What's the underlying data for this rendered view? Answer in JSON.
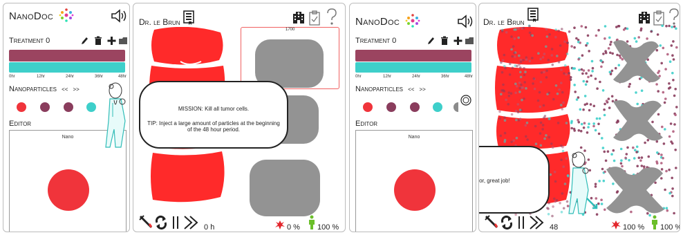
{
  "screen1": {
    "app_name": "NanoDoc",
    "treatment_title": "Treatment 0",
    "timeline_ticks": [
      "0hr",
      "12hr",
      "24hr",
      "36hr",
      "48hr"
    ],
    "nanoparticles_label": "Nanoparticles",
    "np_prev": "<<",
    "np_next": ">>",
    "editor_label": "Editor",
    "editor_canvas_title": "Nano",
    "doctor_name": "Dr. le Brun",
    "grid_value": "1700",
    "mission_text": "MISSION: Kill all tumor cells.",
    "tip_text": "TIP: Inject a large amount of particles at the beginning of the 48 hour period.",
    "timer_value": "0",
    "timer_unit": "h",
    "tumor_killed": "0 %",
    "health": "100 %"
  },
  "screen2": {
    "app_name": "NanoDoc",
    "treatment_title": "Treatment 0",
    "timeline_ticks": [
      "0hr",
      "12hr",
      "24hr",
      "36hr",
      "48hr"
    ],
    "nanoparticles_label": "Nanoparticles",
    "np_prev": "<<",
    "np_next": ">>",
    "editor_label": "Editor",
    "editor_canvas_title": "Nano",
    "doctor_name": "Dr. le Brun",
    "success_text": "You killed the tumor, great job!",
    "timer_value": "48",
    "tumor_killed": "100 %",
    "health": "100 %"
  },
  "colors": {
    "timeline_top": "#9b4460",
    "timeline_bottom": "#3ecfca",
    "particle_red": "#f0343b",
    "particle_plum": "#8a3d5d",
    "particle_teal": "#3ecfca",
    "tissue_red": "#ff2a2a",
    "tumor_gray": "#939393"
  },
  "nanoparticle_palette": [
    "particle_red",
    "particle_plum",
    "particle_plum",
    "particle_teal"
  ]
}
